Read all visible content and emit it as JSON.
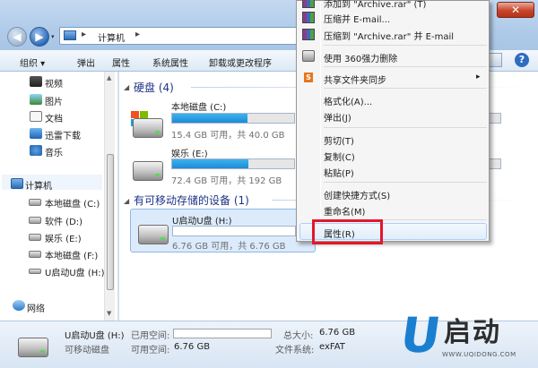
{
  "window": {
    "close_glyph": "✕",
    "address": {
      "separator": "▸",
      "location": "计算机"
    }
  },
  "toolbar": {
    "organize": "组织 ▾",
    "eject": "弹出",
    "properties": "属性",
    "system_properties": "系统属性",
    "uninstall": "卸载或更改程序",
    "help": "?"
  },
  "nav_pane": {
    "libraries": [
      {
        "label": "视频",
        "icon": "video-icon"
      },
      {
        "label": "图片",
        "icon": "picture-icon"
      },
      {
        "label": "文档",
        "icon": "document-icon"
      },
      {
        "label": "迅雷下载",
        "icon": "thunder-download-icon"
      },
      {
        "label": "音乐",
        "icon": "music-icon"
      }
    ],
    "computer": "计算机",
    "drives": [
      {
        "label": "本地磁盘 (C:)"
      },
      {
        "label": "软件 (D:)"
      },
      {
        "label": "娱乐 (E:)"
      },
      {
        "label": "本地磁盘 (F:)"
      },
      {
        "label": "U启动U盘 (H:)"
      }
    ],
    "network": "网络"
  },
  "content": {
    "hard_disk_group": "硬盘 (4)",
    "removable_group": "有可移动存储的设备 (1)",
    "drives": [
      {
        "name": "本地磁盘 (C:)",
        "info": "15.4 GB 可用，共 40.0 GB",
        "used_fraction": 0.615
      },
      {
        "name": "娱乐 (E:)",
        "info": "72.4 GB 可用，共 192 GB",
        "used_fraction": 0.623
      }
    ],
    "usb": {
      "name": "U启动U盘 (H:)",
      "info": "6.76 GB 可用，共 6.76 GB",
      "used_fraction": 0.0
    }
  },
  "context_menu": {
    "items": [
      {
        "label": "添加到 \"Archive.rar\" (T)"
      },
      {
        "label": "压缩并 E-mail..."
      },
      {
        "label": "压缩到 \"Archive.rar\" 并 E-mail"
      },
      {
        "label": "使用 360强力删除"
      },
      {
        "label": "共享文件夹同步",
        "submenu_arrow": "▸"
      },
      {
        "label": "格式化(A)..."
      },
      {
        "label": "弹出(J)"
      },
      {
        "label": "剪切(T)"
      },
      {
        "label": "复制(C)"
      },
      {
        "label": "粘贴(P)"
      },
      {
        "label": "创建快捷方式(S)"
      },
      {
        "label": "重命名(M)"
      },
      {
        "label": "属性(R)"
      }
    ],
    "highlight_color": "#e3172b"
  },
  "status_bar": {
    "name": "U启动U盘 (H:)",
    "type": "可移动磁盘",
    "used_label": "已用空间:",
    "free_label": "可用空间:",
    "free_value": "6.76 GB",
    "total_label": "总大小:",
    "total_value": "6.76 GB",
    "fs_label": "文件系统:",
    "fs_value": "exFAT"
  },
  "logo": {
    "letter": "U",
    "brand": "启动",
    "url": "WWW.UQIDONG.COM",
    "color": "#1b7fd0"
  }
}
